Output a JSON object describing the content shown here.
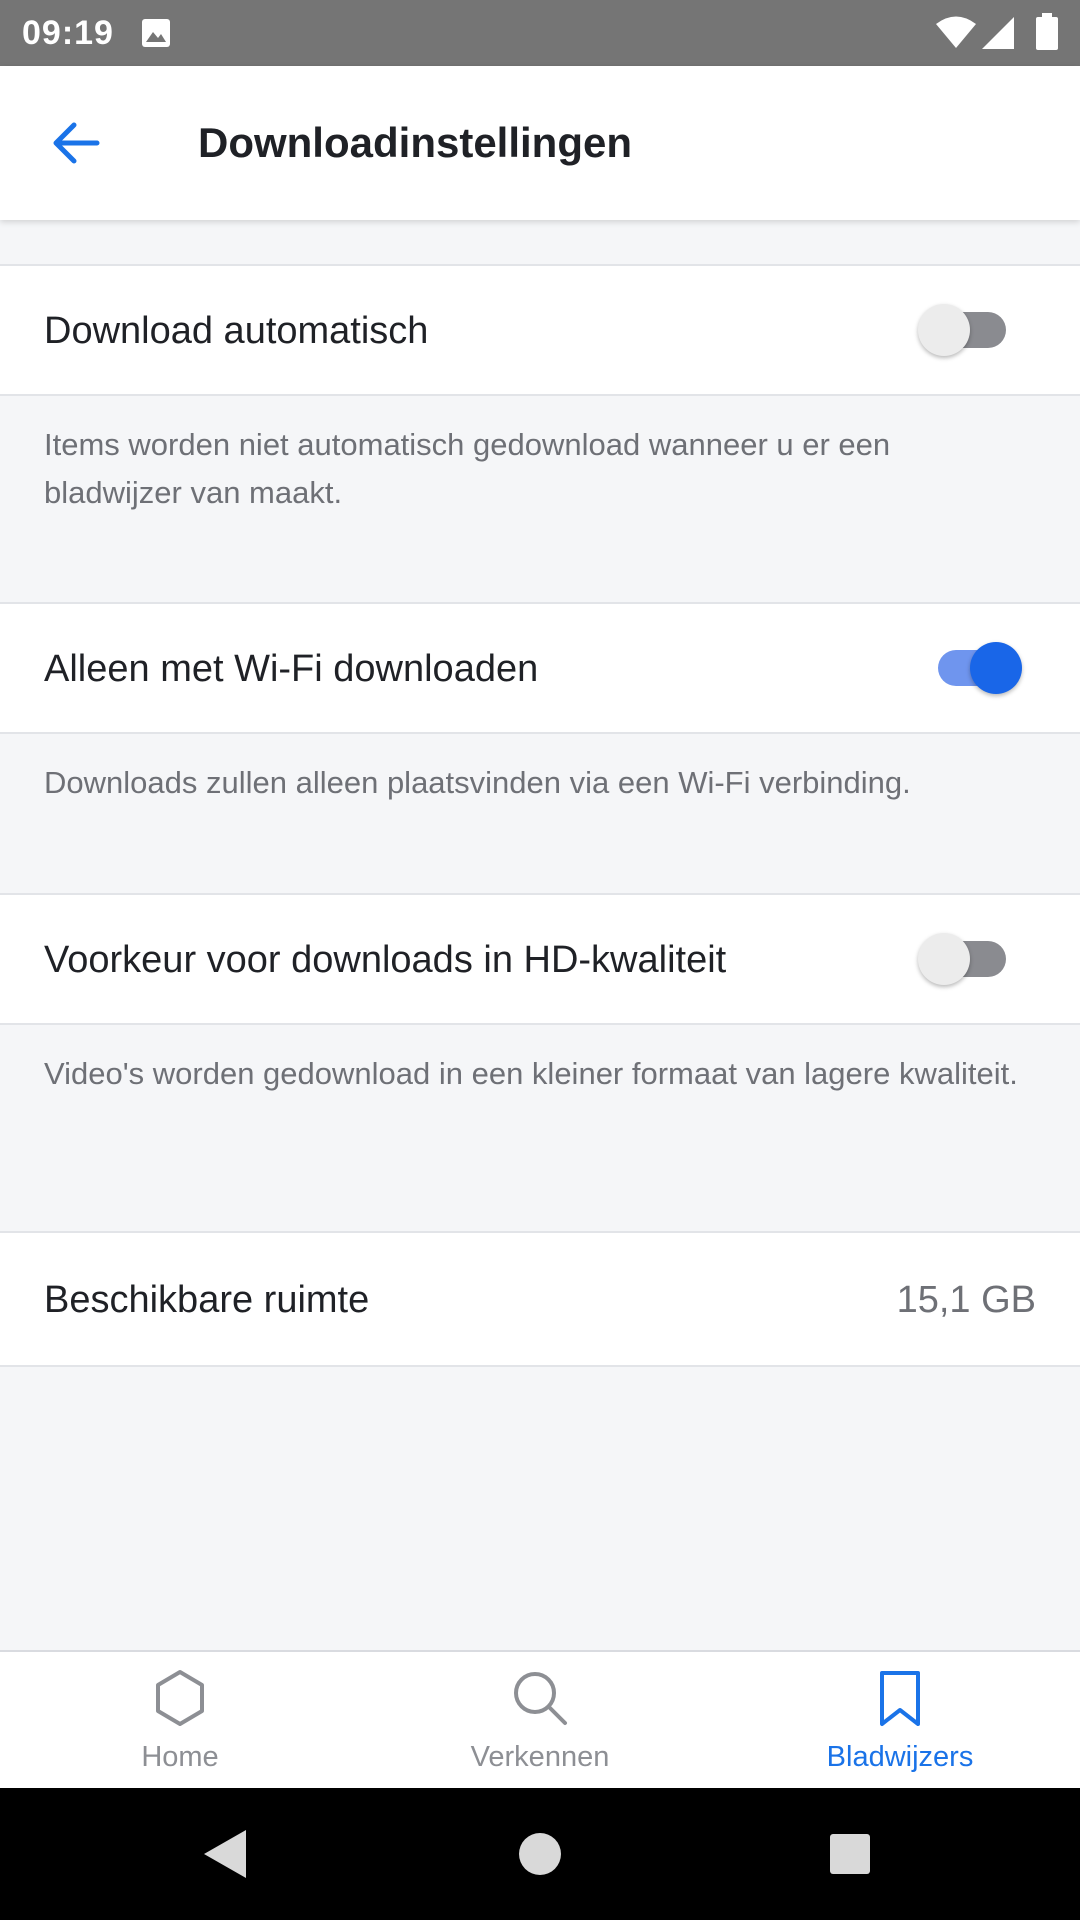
{
  "status_bar": {
    "time": "09:19"
  },
  "app_bar": {
    "title": "Downloadinstellingen"
  },
  "settings": [
    {
      "label": "Download automatisch",
      "enabled": false,
      "description": "Items worden niet automatisch gedownload wanneer u er een bladwijzer van maakt."
    },
    {
      "label": "Alleen met Wi-Fi downloaden",
      "enabled": true,
      "description": "Downloads zullen alleen plaatsvinden via een Wi-Fi verbinding."
    },
    {
      "label": "Voorkeur voor downloads in HD-kwaliteit",
      "enabled": false,
      "description": "Video's worden gedownload in een kleiner formaat van lagere kwaliteit."
    }
  ],
  "storage": {
    "label": "Beschikbare ruimte",
    "value": "15,1 GB"
  },
  "bottom_nav": {
    "items": [
      {
        "label": "Home",
        "icon": "hexagon-icon",
        "active": false
      },
      {
        "label": "Verkennen",
        "icon": "search-icon",
        "active": false
      },
      {
        "label": "Bladwijzers",
        "icon": "bookmark-icon",
        "active": true
      }
    ]
  },
  "colors": {
    "accent": "#1a73e8",
    "toggle_on": "#1966e8",
    "toggle_off_track": "#8a8b90",
    "background": "#f5f6f8"
  }
}
